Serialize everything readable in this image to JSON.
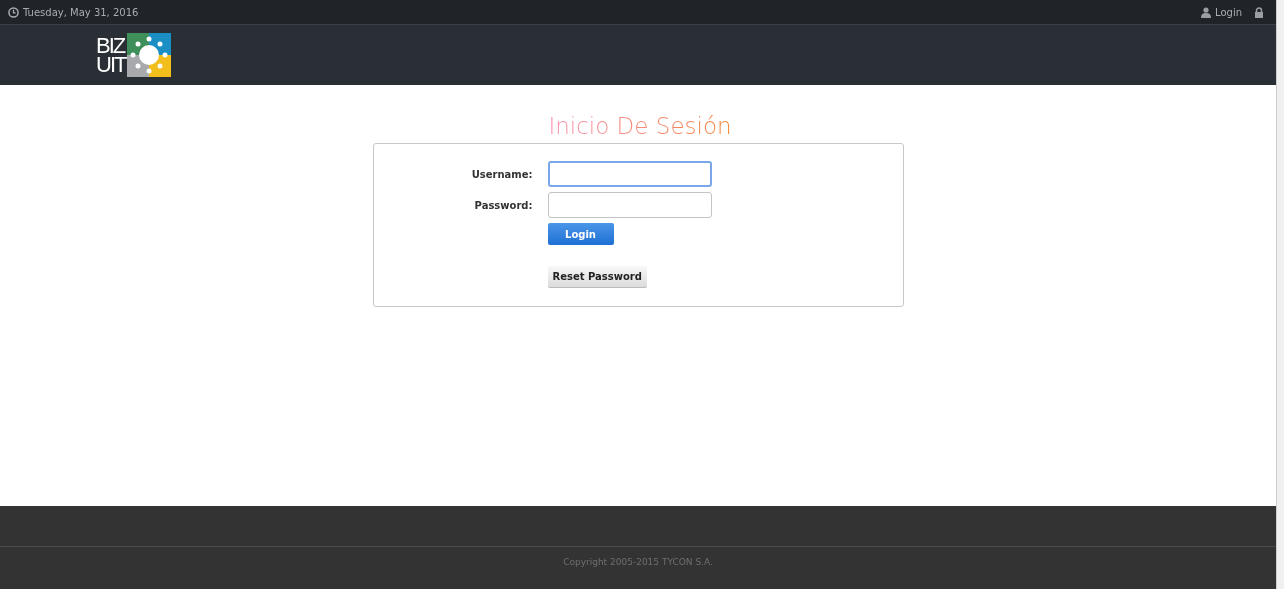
{
  "top_bar": {
    "date": "Tuesday, May 31, 2016",
    "login_link": "Login"
  },
  "logo": {
    "line_1": "BIZ",
    "line_2": "UIT"
  },
  "login_form": {
    "title": "Inicio De Sesión",
    "fields": [
      {
        "label": "Username:",
        "focused": true
      },
      {
        "label": "Password:",
        "focused": false
      }
    ],
    "login_button": "Login",
    "reset_button": "Reset Password"
  },
  "footer": {
    "copyright": "Copyright 2005-2015 TYCON S.A."
  }
}
